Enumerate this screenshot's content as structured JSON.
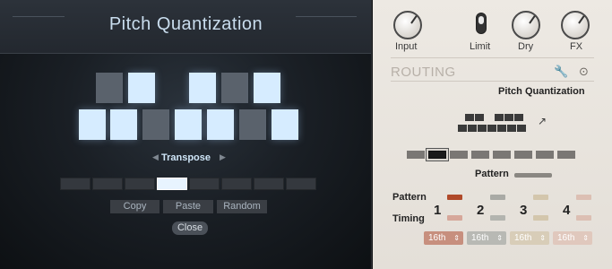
{
  "quantizer": {
    "title": "Pitch Quantization",
    "transpose_label": "Transpose",
    "buttons": {
      "copy": "Copy",
      "paste": "Paste",
      "random": "Random",
      "close": "Close"
    },
    "notes_black": [
      {
        "name": "C#",
        "active": false
      },
      {
        "name": "D#",
        "active": true
      },
      {
        "name": "F#",
        "active": true
      },
      {
        "name": "G#",
        "active": false
      },
      {
        "name": "A#",
        "active": true
      }
    ],
    "notes_white": [
      {
        "name": "C",
        "active": true
      },
      {
        "name": "D",
        "active": true
      },
      {
        "name": "E",
        "active": false
      },
      {
        "name": "F",
        "active": true
      },
      {
        "name": "G",
        "active": true
      },
      {
        "name": "A",
        "active": false
      },
      {
        "name": "B",
        "active": true
      }
    ],
    "pattern_slots": 8,
    "selected_slot": 4
  },
  "controls": {
    "input_label": "Input",
    "limit_label": "Limit",
    "dry_label": "Dry",
    "fx_label": "FX"
  },
  "routing": {
    "title": "ROUTING",
    "module": "Pitch Quantization",
    "pattern_label": "Pattern",
    "selected_pattern": 2,
    "pattern_slots": 8
  },
  "sequencer": {
    "pattern_row_label": "Pattern",
    "timing_row_label": "Timing",
    "lanes": [
      {
        "number": "1",
        "rate": "16th",
        "color": "#b04a2a",
        "active": true
      },
      {
        "number": "2",
        "rate": "16th",
        "color": "#9fa19b",
        "active": false
      },
      {
        "number": "3",
        "rate": "16th",
        "color": "#cfc1a5",
        "active": false
      },
      {
        "number": "4",
        "rate": "16th",
        "color": "#d9b9aa",
        "active": false
      }
    ]
  }
}
